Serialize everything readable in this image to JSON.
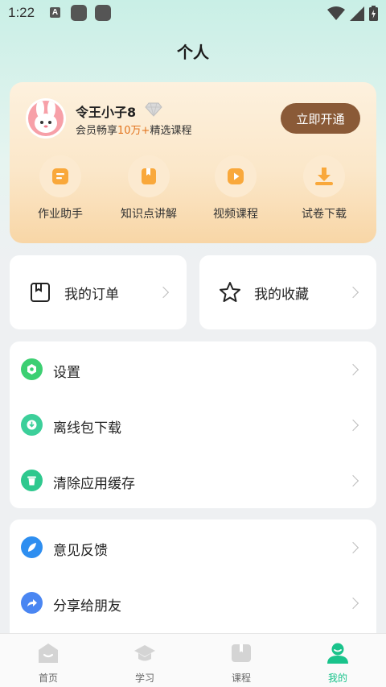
{
  "status_bar": {
    "time": "1:22",
    "notif_letter": "A"
  },
  "header": {
    "title": "个人"
  },
  "vip": {
    "username": "令王小子8",
    "desc_prefix": "会员畅享",
    "desc_highlight": "10万+",
    "desc_suffix": "精选课程",
    "open_button": "立即开通",
    "accent_color": "#8a5a37",
    "features": [
      {
        "label": "作业助手",
        "icon": "homework-icon"
      },
      {
        "label": "知识点讲解",
        "icon": "book-icon"
      },
      {
        "label": "视频课程",
        "icon": "video-play-icon"
      },
      {
        "label": "试卷下载",
        "icon": "download-icon"
      }
    ]
  },
  "quick": {
    "orders": "我的订单",
    "favorites": "我的收藏"
  },
  "settings_group": [
    {
      "label": "设置",
      "icon": "settings-icon",
      "color": "#3ccf72"
    },
    {
      "label": "离线包下载",
      "icon": "offline-download-icon",
      "color": "#3ccf9a"
    },
    {
      "label": "清除应用缓存",
      "icon": "trash-icon",
      "color": "#2ec88e"
    }
  ],
  "support_group": [
    {
      "label": "意见反馈",
      "icon": "feedback-icon",
      "color": "#2e8ef0"
    },
    {
      "label": "分享给朋友",
      "icon": "share-icon",
      "color": "#4a86f2"
    }
  ],
  "tabs": [
    {
      "label": "首页",
      "icon": "home-icon"
    },
    {
      "label": "学习",
      "icon": "graduation-cap-icon"
    },
    {
      "label": "课程",
      "icon": "course-book-icon"
    },
    {
      "label": "我的",
      "icon": "profile-icon",
      "active": true
    }
  ],
  "colors": {
    "active_tab": "#19c38b",
    "background_top": "#c9efe6"
  }
}
